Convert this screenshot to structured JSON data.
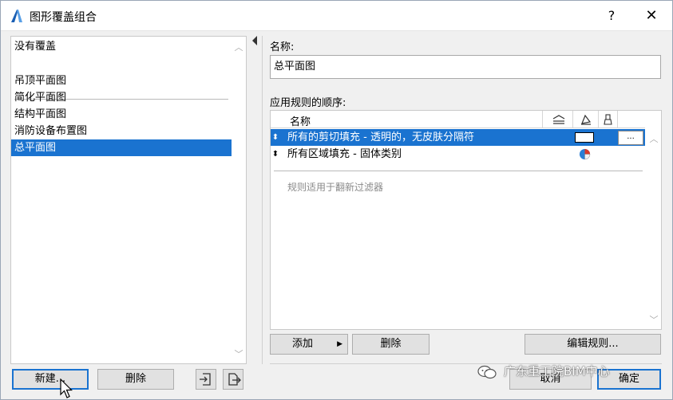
{
  "window": {
    "title": "图形覆盖组合",
    "help_label": "?",
    "close_label": "✕"
  },
  "left_list": {
    "top_item": "没有覆盖",
    "items": [
      "吊顶平面图",
      "简化平面图",
      "结构平面图",
      "消防设备布置图",
      "总平面图"
    ],
    "selected_index": 4
  },
  "right": {
    "name_label": "名称:",
    "name_value": "总平面图",
    "rules_label": "应用规则的顺序:",
    "rules_header_name": "名称",
    "rules": [
      {
        "text": "所有的剪切填充 - 透明的，无皮肤分隔符",
        "selected": true,
        "more_label": "..."
      },
      {
        "text": "所有区域填充 - 固体类别",
        "selected": false
      }
    ],
    "rules_hint": "规则适用于翻新过滤器"
  },
  "buttons": {
    "add": "添加",
    "delete_rule": "删除",
    "edit_rules": "编辑规则...",
    "new": "新建...",
    "delete_combo": "删除",
    "cancel": "取消",
    "ok": "确定"
  },
  "watermark": {
    "text": "广东重工院BIM中心"
  },
  "colors": {
    "selection": "#1a73d0",
    "window_bg": "#f0f0f0"
  }
}
